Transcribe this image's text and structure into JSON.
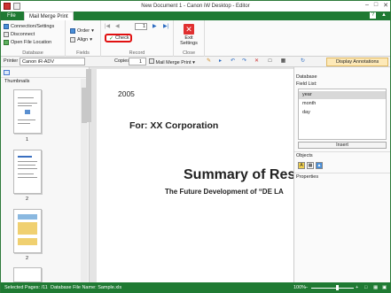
{
  "window": {
    "title": "New Document 1 - Canon iW Desktop - Editor"
  },
  "tabs": {
    "file": "File",
    "mail_merge_print": "Mail Merge Print"
  },
  "ribbon": {
    "database": {
      "connection_settings": "Connection/Settings",
      "disconnect": "Disconnect",
      "open_file_location": "Open File Location",
      "label": "Database"
    },
    "fields": {
      "order": "Order",
      "align": "Align",
      "label": "Fields"
    },
    "record": {
      "check": "Check",
      "current": "1",
      "label": "Record"
    },
    "close": {
      "exit_settings": "Exit Settings",
      "label": "Close"
    }
  },
  "toolbar": {
    "printer_label": "Printer",
    "printer_value": "Canon iR-ADV",
    "copies_label": "Copies",
    "copies_value": "1",
    "print_button": "Mail Merge Print",
    "display_annotations": "Display Annotations"
  },
  "left_panel": {
    "thumbnails_label": "Thumbnails",
    "page_numbers": [
      "1",
      "2",
      "2"
    ]
  },
  "document": {
    "year": "2005",
    "corporation": "For: XX Corporation",
    "title": "Summary of Res",
    "subtitle": "The Future Development of “DE LA"
  },
  "right_panel": {
    "database_label": "Database",
    "field_list_label": "Field List:",
    "fields": [
      "year",
      "month",
      "day"
    ],
    "selected_field": "year",
    "insert_button": "Insert",
    "objects_label": "Objects",
    "properties_label": "Properties"
  },
  "status": {
    "selected_pages": "Selected Pages: /11",
    "database_file": "Database File Name: Sample.xls",
    "zoom": "100%"
  }
}
